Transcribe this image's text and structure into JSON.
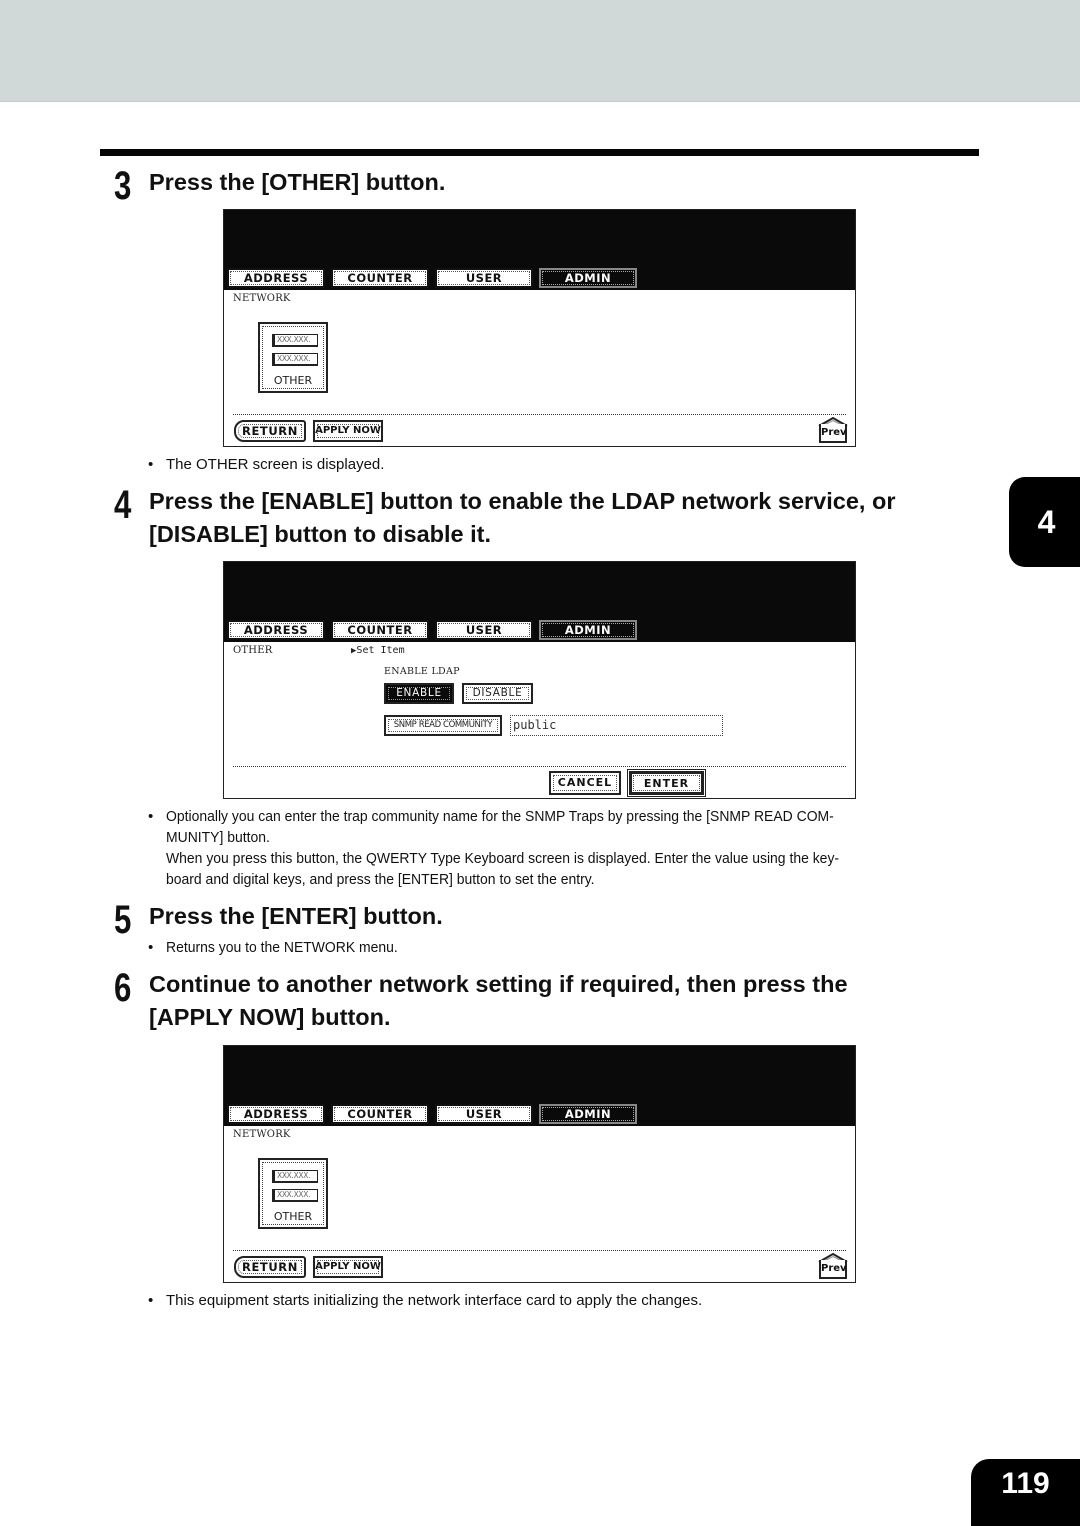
{
  "page": {
    "chapter_tab": "4",
    "page_number": "119"
  },
  "steps": [
    {
      "number": "3",
      "title": "Press the [OTHER] button.",
      "bullets": [
        "The OTHER screen is displayed."
      ]
    },
    {
      "number": "4",
      "title_line1": "Press the [ENABLE] button to enable the LDAP network service, or",
      "title_line2": "[DISABLE] button to disable it.",
      "bullets": [
        "Optionally you can enter the trap community name for the SNMP Traps by pressing the [SNMP READ COM-",
        "MUNITY] button.",
        "When you press this button, the QWERTY Type Keyboard  screen is displayed.  Enter the value using the key-",
        "board and digital keys, and press the [ENTER] button to set the entry."
      ]
    },
    {
      "number": "5",
      "title": "Press the [ENTER] button.",
      "bullets": [
        "Returns you to the NETWORK menu."
      ]
    },
    {
      "number": "6",
      "title_line1": "Continue to another network setting if required, then press the",
      "title_line2": "[APPLY NOW] button.",
      "bullets": [
        "This equipment starts initializing the network interface card to apply the changes."
      ]
    }
  ],
  "bullet_char": "•",
  "panels": {
    "tabs": [
      "ADDRESS",
      "COUNTER",
      "USER",
      "ADMIN"
    ],
    "active_tab": "ADMIN",
    "network_screen": {
      "label": "NETWORK",
      "other_button": {
        "label": "OTHER",
        "field_placeholder_1": "XXX.XXX.",
        "field_placeholder_2": "XXX.XXX."
      },
      "return_label": "RETURN",
      "apply_now_label": "APPLY NOW",
      "prev_label": "Prev"
    },
    "other_screen": {
      "label": "OTHER",
      "set_item_marker": "▶",
      "set_item_label": "Set Item",
      "field_heading": "ENABLE LDAP",
      "enable_label": "ENABLE",
      "disable_label": "DISABLE",
      "selected_option": "ENABLE",
      "snmp_button_label": "SNMP READ COMMUNITY",
      "snmp_value": "public",
      "cancel_label": "CANCEL",
      "enter_label": "ENTER"
    }
  }
}
